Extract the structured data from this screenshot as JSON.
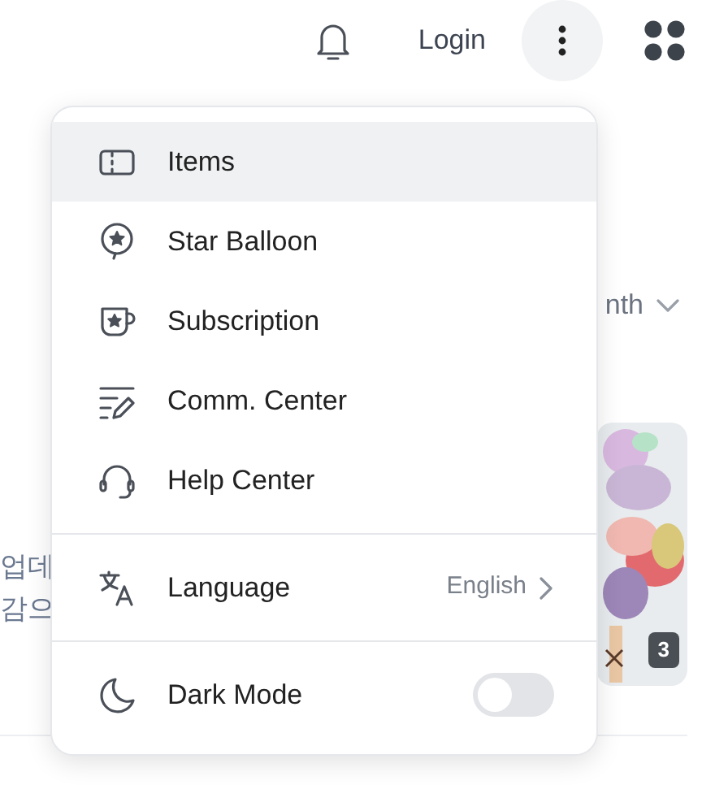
{
  "header": {
    "login": "Login",
    "more_button": {
      "active": true
    }
  },
  "background": {
    "sort_label": "nth",
    "text_lines": [
      "업데",
      "감으"
    ],
    "image_badge": "3"
  },
  "menu": {
    "items": [
      {
        "label": "Items",
        "kind": "ticket",
        "selected": true
      },
      {
        "label": "Star Balloon",
        "kind": "balloon",
        "selected": false
      },
      {
        "label": "Subscription",
        "kind": "mug",
        "selected": false
      },
      {
        "label": "Comm. Center",
        "kind": "edit",
        "selected": false
      },
      {
        "label": "Help Center",
        "kind": "headset",
        "selected": false
      }
    ],
    "language": {
      "label": "Language",
      "value": "English"
    },
    "dark_mode": {
      "label": "Dark Mode",
      "on": false
    }
  }
}
